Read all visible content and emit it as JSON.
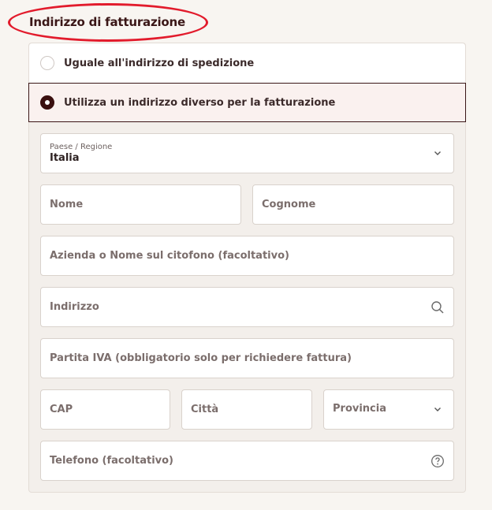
{
  "section": {
    "title": "Indirizzo di fatturazione"
  },
  "options": [
    {
      "label": "Uguale all'indirizzo di spedizione",
      "selected": false
    },
    {
      "label": "Utilizza un indirizzo diverso per la fatturazione",
      "selected": true
    }
  ],
  "form": {
    "country_label": "Paese / Regione",
    "country_value": "Italia",
    "first_name_placeholder": "Nome",
    "last_name_placeholder": "Cognome",
    "company_placeholder": "Azienda o Nome sul citofono (facoltativo)",
    "address_placeholder": "Indirizzo",
    "vat_placeholder": "Partita IVA (obbligatorio solo per richiedere fattura)",
    "zip_placeholder": "CAP",
    "city_placeholder": "Città",
    "province_placeholder": "Provincia",
    "phone_placeholder": "Telefono (facoltativo)"
  },
  "icons": {
    "country": "chevron-down-icon",
    "address": "search-icon",
    "province": "chevron-down-icon",
    "phone": "help-circle-icon"
  },
  "colors": {
    "highlight": "#e21b2c",
    "accent": "#3a0f0f"
  }
}
